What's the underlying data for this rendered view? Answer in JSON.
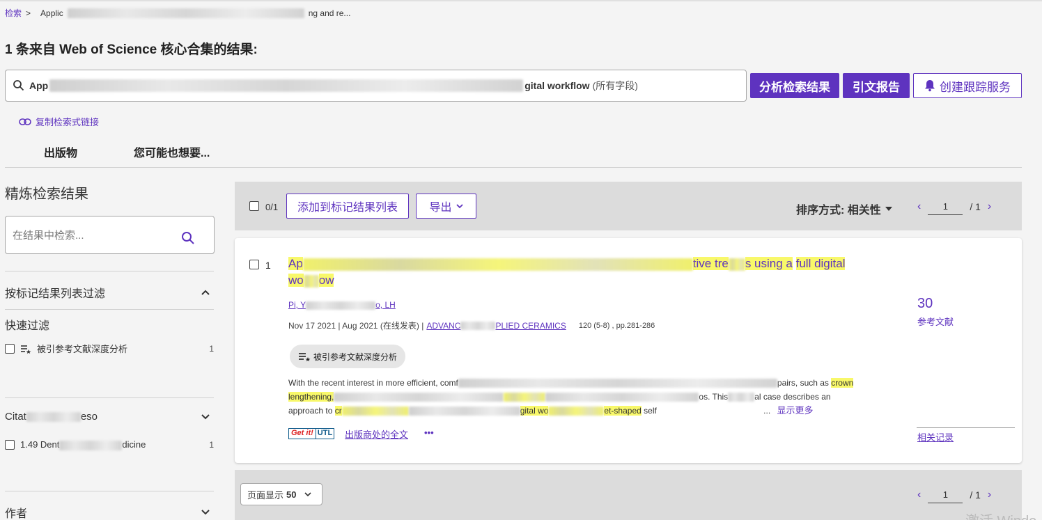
{
  "breadcrumb": {
    "home": "检索",
    "separator": ">",
    "current_start": "Applic",
    "current_end": "ng and re..."
  },
  "heading": "1 条来自 Web of Science 核心合集的结果:",
  "search": {
    "query_start": "App",
    "query_end": "gital workflow",
    "scope": "(所有字段)"
  },
  "actions": {
    "analyze": "分析检索结果",
    "citation_report": "引文报告",
    "create_alert": "创建跟踪服务"
  },
  "copy_link": "复制检索式链接",
  "tabs": [
    "出版物",
    "您可能也想要..."
  ],
  "refine": {
    "title": "精炼检索结果",
    "search_placeholder": "在结果中检索...",
    "marked_list_filter": "按标记结果列表过滤",
    "quick_filter_title": "快速过滤",
    "quick_filter_item": "被引参考文献深度分析",
    "quick_filter_count": "1",
    "citation_topics_start": "Citat",
    "citation_topics_end": "eso",
    "citation_item_start": "1.49 Dent",
    "citation_item_end": "dicine",
    "citation_item_count": "1",
    "authors": "作者"
  },
  "toolbar": {
    "selected": "0/1",
    "add_to_marked": "添加到标记结果列表",
    "export": "导出",
    "sort_label": "排序方式: 相关性",
    "page": "1",
    "total_pages": "/ 1"
  },
  "result": {
    "index": "1",
    "title_start": "Ap",
    "title_mid": "tive tre",
    "title_end_a": "s using a",
    "title_end_b": "full digital",
    "title_line2_start": "wo",
    "title_line2_end": "ow",
    "authors_start": "Pi, Y",
    "authors_end": "o, LH",
    "dates": "Nov 17 2021 | Aug 2021 (在线发表) |",
    "journal_start": "ADVANC",
    "journal_end": "PLIED CERAMICS",
    "volume": "120 (5-8) , pp.281-286",
    "deep_analysis": "被引参考文献深度分析",
    "abstract_line1_start": "With the recent interest in more efficient, comf",
    "abstract_line1_end": "pairs, such as",
    "abstract_line1_hl": "crown",
    "abstract_line2_hl": "lengthening,",
    "abstract_line2_end": "os. This",
    "abstract_line2_end2": "al case describes an",
    "abstract_line3_start": "approach to",
    "abstract_line3_hl1": "cr",
    "abstract_line3_hl2": "gital wo",
    "abstract_line3_hl3": "et-shaped",
    "abstract_line3_end": "self",
    "ellipsis": "...",
    "show_more": "显示更多",
    "getit": "Get it!",
    "utl": "UTL",
    "fulltext": "出版商处的全文",
    "more": "•••",
    "references_count": "30",
    "references_label": "参考文献",
    "related_records": "相关记录"
  },
  "bottom": {
    "per_page_label": "页面显示",
    "per_page_value": "50",
    "page": "1",
    "total_pages": "/ 1"
  },
  "watermark": "激活 Windo",
  "colors": {
    "accent": "#5e33bf",
    "highlight": "#f8f86a",
    "toolbar_bg": "#dcdcdc",
    "page_bg": "#f4f4f4"
  }
}
